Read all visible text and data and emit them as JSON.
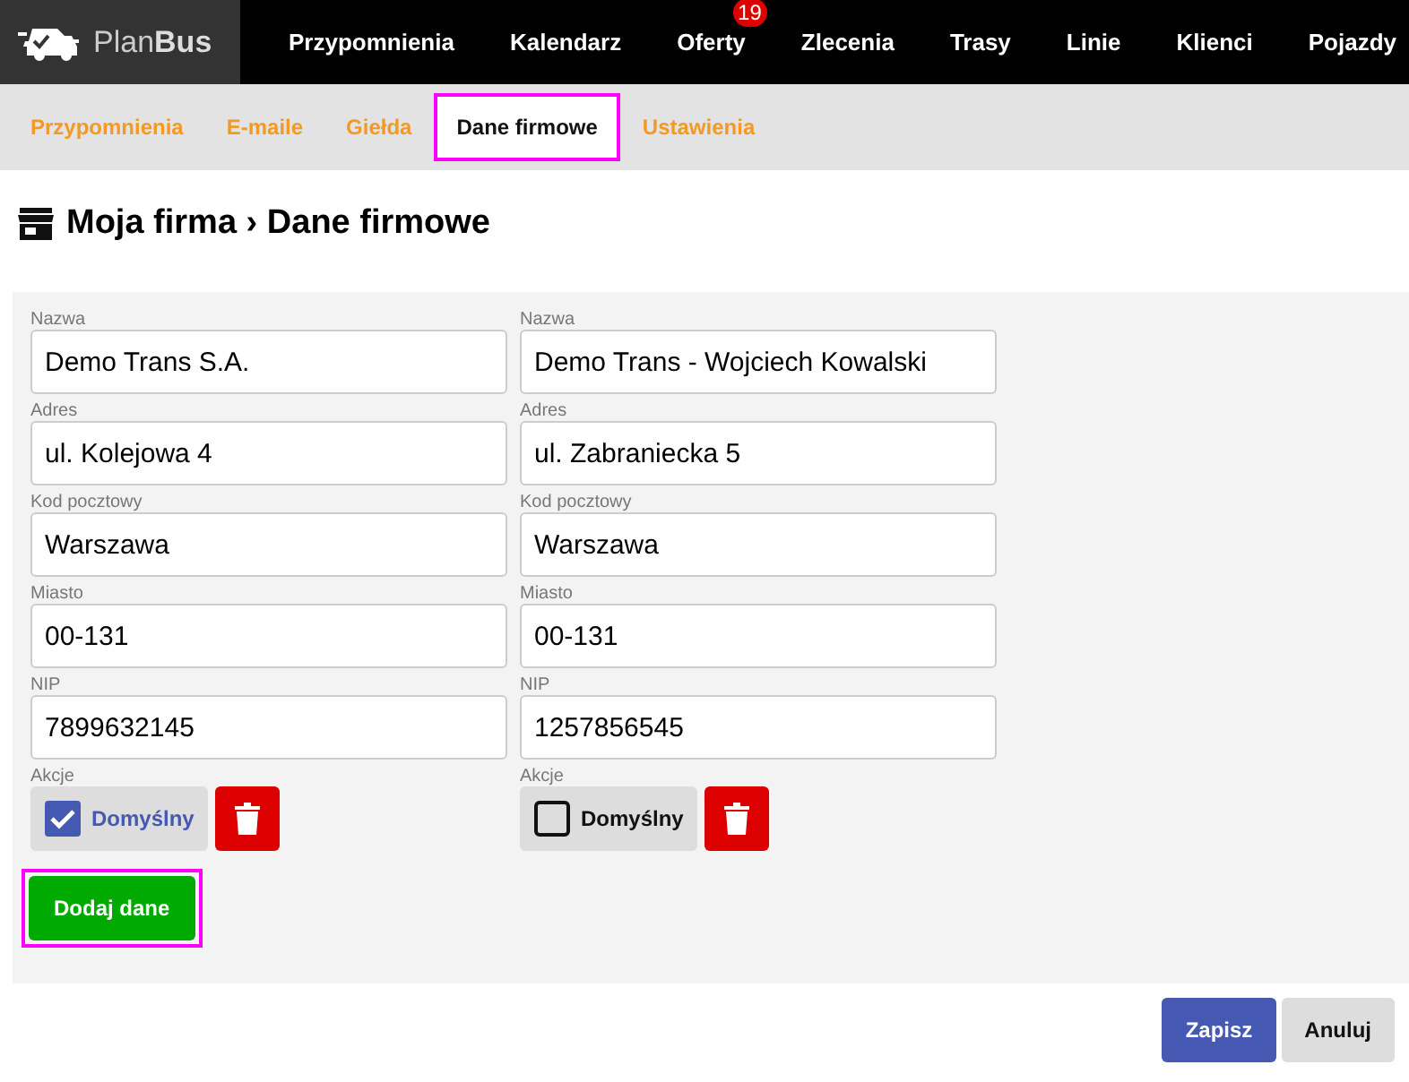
{
  "logo": {
    "text_light": "Plan",
    "text_bold": "Bus"
  },
  "nav": [
    {
      "label": "Przypomnienia"
    },
    {
      "label": "Kalendarz"
    },
    {
      "label": "Oferty",
      "badge": "19"
    },
    {
      "label": "Zlecenia"
    },
    {
      "label": "Trasy"
    },
    {
      "label": "Linie"
    },
    {
      "label": "Klienci"
    },
    {
      "label": "Pojazdy"
    }
  ],
  "tabs": [
    {
      "label": "Przypomnienia",
      "selected": false
    },
    {
      "label": "E-maile",
      "selected": false
    },
    {
      "label": "Giełda",
      "selected": false
    },
    {
      "label": "Dane firmowe",
      "selected": true
    },
    {
      "label": "Ustawienia",
      "selected": false
    }
  ],
  "heading": "Moja firma › Dane firmowe",
  "companies": [
    {
      "fields": [
        {
          "label": "Nazwa",
          "value": "Demo Trans S.A."
        },
        {
          "label": "Adres",
          "value": "ul. Kolejowa 4"
        },
        {
          "label": "Kod pocztowy",
          "value": "Warszawa"
        },
        {
          "label": "Miasto",
          "value": "00-131"
        },
        {
          "label": "NIP",
          "value": "7899632145"
        }
      ],
      "actions_label": "Akcje",
      "default_label": "Domyślny",
      "checked": true
    },
    {
      "fields": [
        {
          "label": "Nazwa",
          "value": "Demo Trans - Wojciech Kowalski"
        },
        {
          "label": "Adres",
          "value": "ul. Zabraniecka 5"
        },
        {
          "label": "Kod pocztowy",
          "value": "Warszawa"
        },
        {
          "label": "Miasto",
          "value": "00-131"
        },
        {
          "label": "NIP",
          "value": "1257856545"
        }
      ],
      "actions_label": "Akcje",
      "default_label": "Domyślny",
      "checked": false
    }
  ],
  "add_button": {
    "label": "Dodaj dane",
    "highlighted": true
  },
  "buttons": [
    {
      "kind": "primary",
      "label": "Zapisz"
    },
    {
      "kind": "secondary",
      "label": "Anuluj"
    }
  ]
}
